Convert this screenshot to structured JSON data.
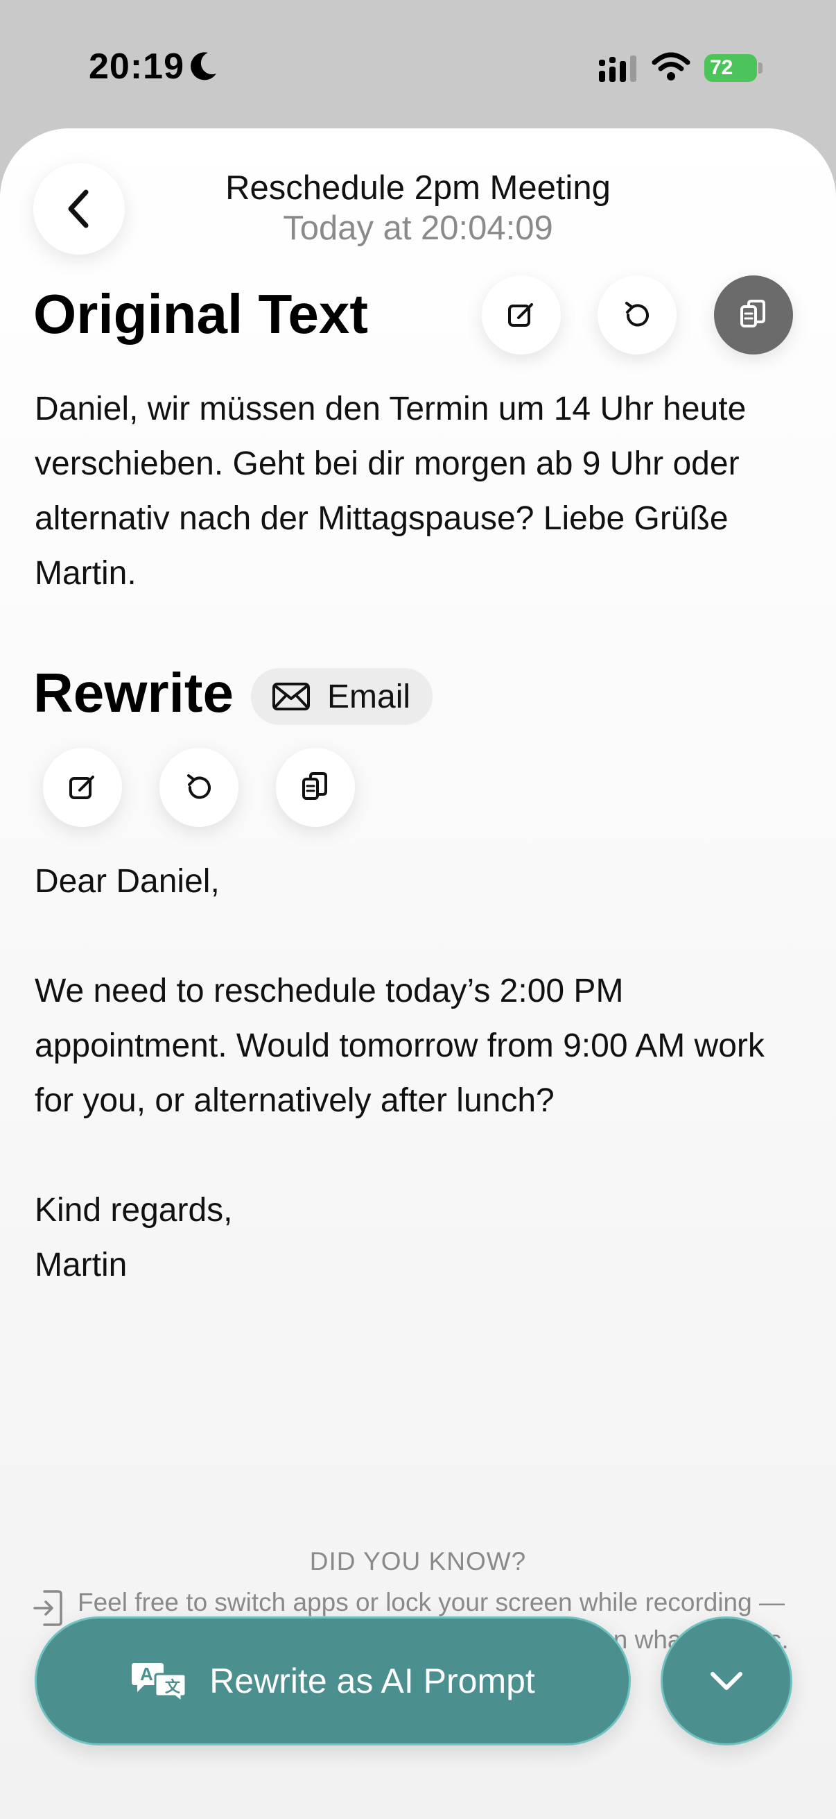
{
  "status_bar": {
    "time": "20:19",
    "battery": "72",
    "icons": [
      "moon-icon",
      "signal-icon",
      "wifi-icon",
      "battery-icon"
    ]
  },
  "header": {
    "title": "Reschedule 2pm Meeting",
    "subtitle": "Today at 20:04:09",
    "back_icon": "chevron-left-icon"
  },
  "original": {
    "heading": "Original Text",
    "text": "Daniel, wir müssen den Termin um 14 Uhr heute verschieben. Geht bei dir morgen ab 9 Uhr oder alternativ nach der Mittagspause? Liebe Grüße Martin.",
    "actions": [
      "edit-icon",
      "refresh-icon",
      "copy-icon"
    ]
  },
  "rewrite": {
    "heading": "Rewrite",
    "chip_label": "Email",
    "chip_icon": "envelope-icon",
    "actions": [
      "edit-icon",
      "refresh-icon",
      "copy-icon"
    ],
    "text": "Dear Daniel,\n\nWe need to reschedule today’s 2:00 PM appointment. Would tomorrow from 9:00 AM work for you, or alternatively after lunch?\n\nKind regards,\nMartin"
  },
  "did_you_know": {
    "title": "DID YOU KNOW?",
    "text": "Feel free to switch apps or lock your screen while recording — Yappee keeps going so you can stay focused on what matters.",
    "icon": "enter-app-icon"
  },
  "footer": {
    "primary_label": "Rewrite as AI Prompt",
    "primary_icon": "translate-icon",
    "expand_icon": "chevron-down-icon"
  },
  "colors": {
    "accent": "#4b8f8f",
    "accent_border": "#6fc2c0",
    "battery": "#4cc45a",
    "muted_text": "#8a8a8a"
  }
}
